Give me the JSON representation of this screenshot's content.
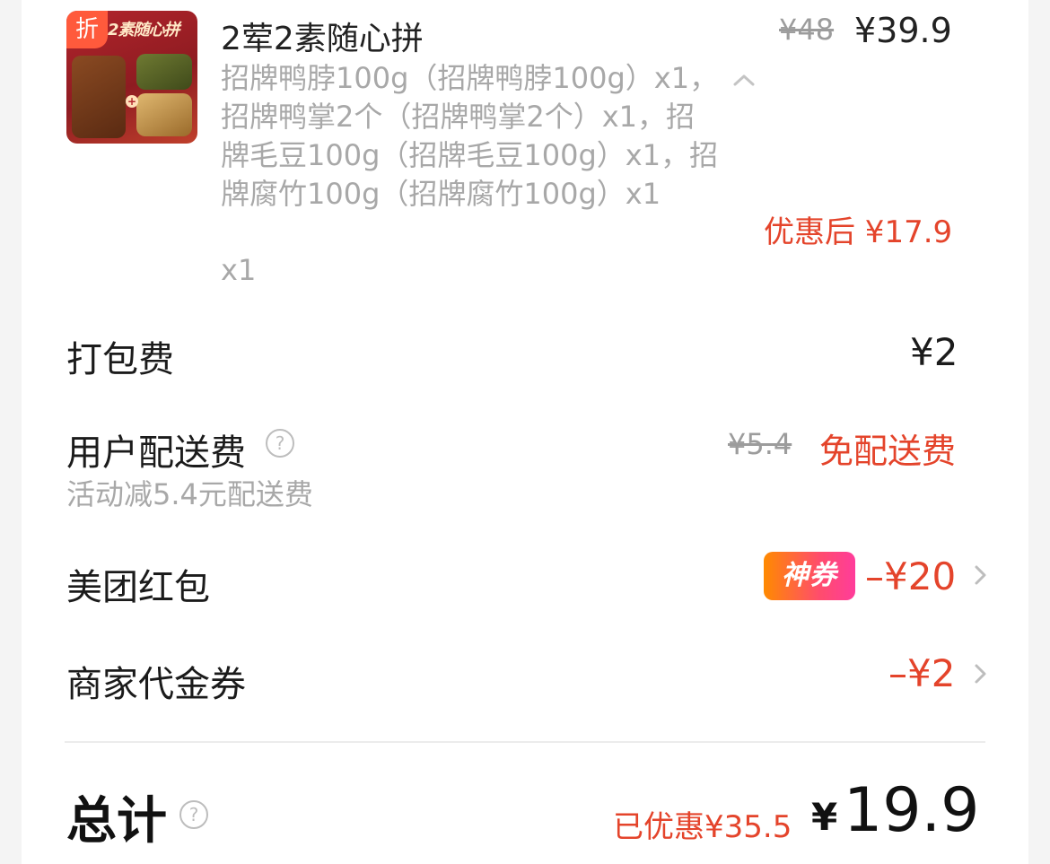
{
  "product": {
    "badge": "折",
    "banner": "2素随心拼",
    "title": "2荤2素随心拼",
    "description": "招牌鸭脖100g（招牌鸭脖100g）x1，招牌鸭掌2个（招牌鸭掌2个）x1，招牌毛豆100g（招牌毛豆100g）x1，招牌腐竹100g（招牌腐竹100g）x1",
    "quantity": "x1",
    "original_price": "¥48",
    "price": "¥39.9",
    "after_discount": "优惠后 ¥17.9",
    "collapse_icon": "chevron-up-icon"
  },
  "packing": {
    "label": "打包费",
    "value": "¥2"
  },
  "delivery": {
    "label": "用户配送费",
    "help_icon": "?",
    "sub": "活动减5.4元配送费",
    "original": "¥5.4",
    "value": "免配送费"
  },
  "redpacket": {
    "label": "美团红包",
    "badge": "神券",
    "value": "–¥20"
  },
  "voucher": {
    "label": "商家代金券",
    "value": "–¥2"
  },
  "total": {
    "label": "总计",
    "help_icon": "?",
    "saved": "已优惠¥35.5",
    "currency": "¥",
    "value": "19.9"
  },
  "colors": {
    "accent": "#e4442b",
    "muted": "#a8a8a8",
    "text": "#1b1b1b"
  }
}
